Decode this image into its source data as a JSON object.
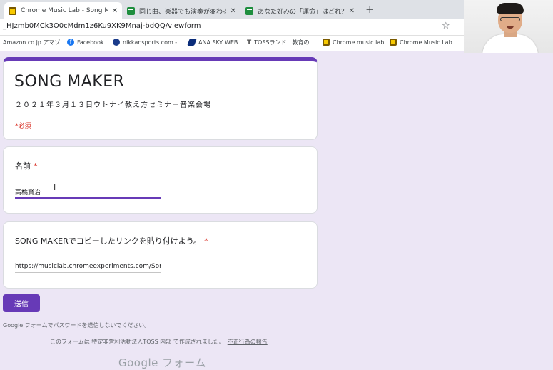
{
  "browser": {
    "tabs": [
      {
        "title": "Chrome Music Lab - Song Maker",
        "favicon": "chrome-music-lab-icon",
        "active": true
      },
      {
        "title": "同じ曲、楽器でも演奏が変わるのは",
        "favicon": "google-sheets-icon",
        "active": false
      },
      {
        "title": "あなた好みの「運命」はどれ？（図画",
        "favicon": "google-sheets-icon",
        "active": false
      }
    ],
    "close_glyph": "✕",
    "new_tab_glyph": "+",
    "url": "_HJzmb0MCk3O0cMdm1z6Ku9XK9Mnaj-bdQQ/viewform",
    "star_glyph": "☆",
    "bookmarks": [
      {
        "label": "Amazon.co.jp アマゾ...",
        "icon": "none"
      },
      {
        "label": "Facebook",
        "icon": "facebook-icon"
      },
      {
        "label": "nikkansports.com -...",
        "icon": "nikkansports-icon"
      },
      {
        "label": "ANA SKY WEB",
        "icon": "ana-icon"
      },
      {
        "label": "TOSSランド：教育の...",
        "icon": "toss-icon"
      },
      {
        "label": "Chrome music lab",
        "icon": "chrome-music-lab-icon"
      },
      {
        "label": "Chrome Music Lab...",
        "icon": "chrome-music-lab-icon"
      }
    ],
    "toss_mark": "T"
  },
  "form": {
    "title": "SONG MAKER",
    "description": "２０２１年３月１３日ウトナイ教え方セミナー音楽会場",
    "required_note": "*必須",
    "questions": [
      {
        "label": "名前",
        "required_mark": "*",
        "value": "高橋賢治"
      },
      {
        "label": "SONG MAKERでコピーしたリンクを貼り付けよう。",
        "required_mark": "*",
        "value": "https://musiclab.chromeexperiments.com/Sor"
      }
    ],
    "submit_label": "送信",
    "password_warning": "Google フォームでパスワードを送信しないでください。",
    "created_by": "このフォームは 特定非営利活動法人TOSS 内部 で作成されました。",
    "report_link": "不正行為の報告",
    "brand": "Google フォーム"
  },
  "colors": {
    "accent": "#673ab7",
    "required": "#d93025",
    "background": "#ece6f5"
  }
}
